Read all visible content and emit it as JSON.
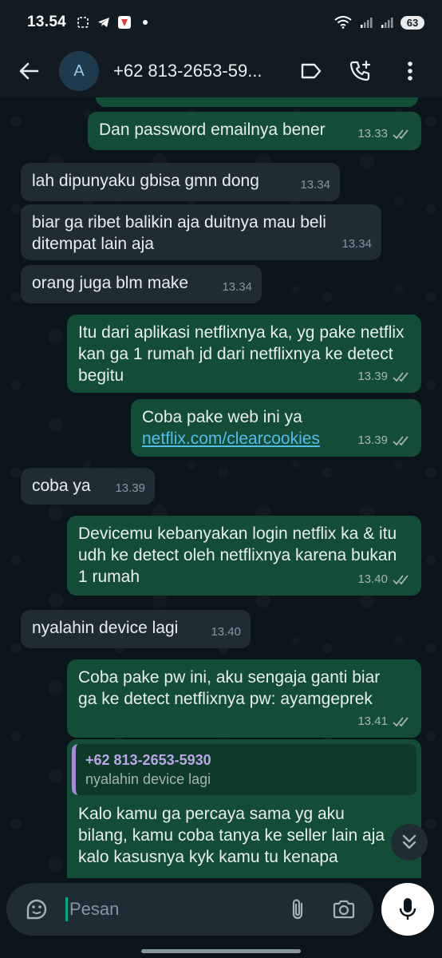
{
  "status_bar": {
    "time": "13.54",
    "battery": "63"
  },
  "header": {
    "avatar_letter": "A",
    "contact_name": "+62 813-2653-59..."
  },
  "messages": [
    {
      "dir": "out",
      "text": "Dan password emailnya bener",
      "time": "13.33",
      "read": true
    },
    {
      "dir": "in",
      "text": "lah dipunyaku gbisa gmn dong",
      "time": "13.34"
    },
    {
      "dir": "in",
      "text": "biar ga ribet balikin aja duitnya mau beli ditempat lain aja",
      "time": "13.34"
    },
    {
      "dir": "in",
      "text": "orang juga blm make",
      "time": "13.34"
    },
    {
      "dir": "out",
      "text": "Itu dari aplikasi netflixnya ka, yg pake netflix kan ga 1 rumah jd dari netflixnya ke detect begitu",
      "time": "13.39",
      "read": true
    },
    {
      "dir": "out",
      "text": "Coba pake web ini ya",
      "link": "netflix.com/clearcookies",
      "time": "13.39",
      "read": true
    },
    {
      "dir": "in",
      "text": "coba ya",
      "time": "13.39"
    },
    {
      "dir": "out",
      "text": "Devicemu kebanyakan login netflix ka & itu udh ke detect oleh netflixnya karena bukan 1 rumah",
      "time": "13.40",
      "read": true
    },
    {
      "dir": "in",
      "text": "nyalahin device lagi",
      "time": "13.40"
    },
    {
      "dir": "out",
      "text": "Coba pake pw ini, aku sengaja ganti biar ga ke detect netflixnya pw: ayamgeprek",
      "time": "13.41",
      "read": true
    },
    {
      "dir": "out",
      "quote_name": "+62 813-2653-5930",
      "quote_text": "nyalahin device lagi",
      "text": "Kalo kamu ga percaya sama yg aku bilang, kamu coba tanya ke seller lain aja kalo kasusnya kyk kamu tu kenapa"
    }
  ],
  "composer": {
    "placeholder": "Pesan"
  },
  "colors": {
    "incoming": "#202c33",
    "outgoing": "#144d37",
    "accent": "#00a884",
    "link": "#53bdeb"
  }
}
